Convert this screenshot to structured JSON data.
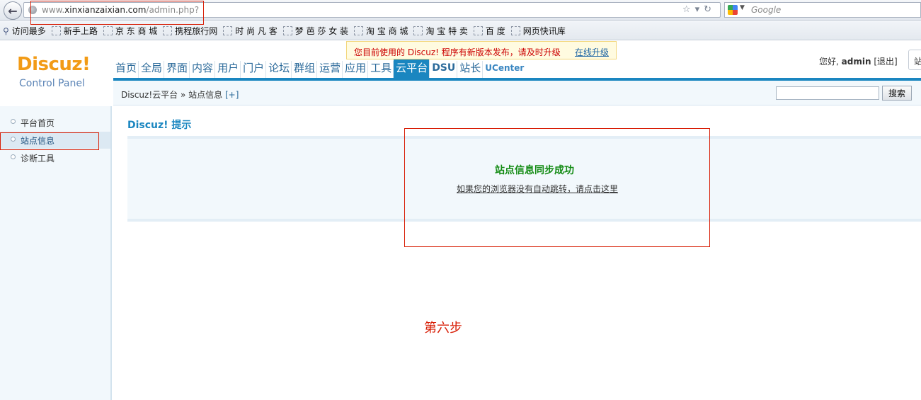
{
  "browser": {
    "url_prefix": "www.",
    "url_host": "xinxianzaixian.com",
    "url_path": "/admin.php?",
    "search_placeholder": "Google"
  },
  "bookmarks": [
    {
      "label": "访问最多",
      "icon": "magnifier-icon"
    },
    {
      "label": "新手上路",
      "icon": "bookmark-icon"
    },
    {
      "label": "京 东 商 城",
      "icon": "bookmark-icon"
    },
    {
      "label": "携程旅行网",
      "icon": "bookmark-icon"
    },
    {
      "label": "时 尚 凡 客",
      "icon": "bookmark-icon"
    },
    {
      "label": "梦 芭 莎 女 装",
      "icon": "bookmark-icon"
    },
    {
      "label": "淘 宝 商 城",
      "icon": "bookmark-icon"
    },
    {
      "label": "淘 宝 特 卖",
      "icon": "bookmark-icon"
    },
    {
      "label": "百 度",
      "icon": "bookmark-icon"
    },
    {
      "label": "网页快讯库",
      "icon": "bookmark-icon"
    }
  ],
  "logo": {
    "name": "Discuz!",
    "subtitle": "Control Panel"
  },
  "nav": {
    "items": [
      "首页",
      "全局",
      "界面",
      "内容",
      "用户",
      "门户",
      "论坛",
      "群组",
      "运营",
      "应用",
      "工具",
      "云平台",
      "DSU",
      "站长",
      "UCenter"
    ],
    "active": "云平台"
  },
  "notice": {
    "text": "您目前使用的 Discuz! 程序有新版本发布，请及时升级",
    "link": "在线升级"
  },
  "user": {
    "greeting": "您好,",
    "name": "admin",
    "logout": "[退出]",
    "site_btn": "站"
  },
  "breadcrumb": {
    "text": "Discuz!云平台 » 站点信息",
    "plus": "[+]"
  },
  "top_search": {
    "button": "搜索"
  },
  "sidebar": {
    "items": [
      {
        "label": "平台首页",
        "active": false
      },
      {
        "label": "站点信息",
        "active": true
      },
      {
        "label": "诊断工具",
        "active": false
      }
    ]
  },
  "main": {
    "title": "Discuz! 提示",
    "success": "站点信息同步成功",
    "redirect": "如果您的浏览器没有自动跳转，请点击这里"
  },
  "annotation": {
    "step": "第六步"
  },
  "colors": {
    "accent": "#1a86c0",
    "annotation": "#d81e06",
    "success": "#138b13",
    "logo": "#f29b16"
  }
}
